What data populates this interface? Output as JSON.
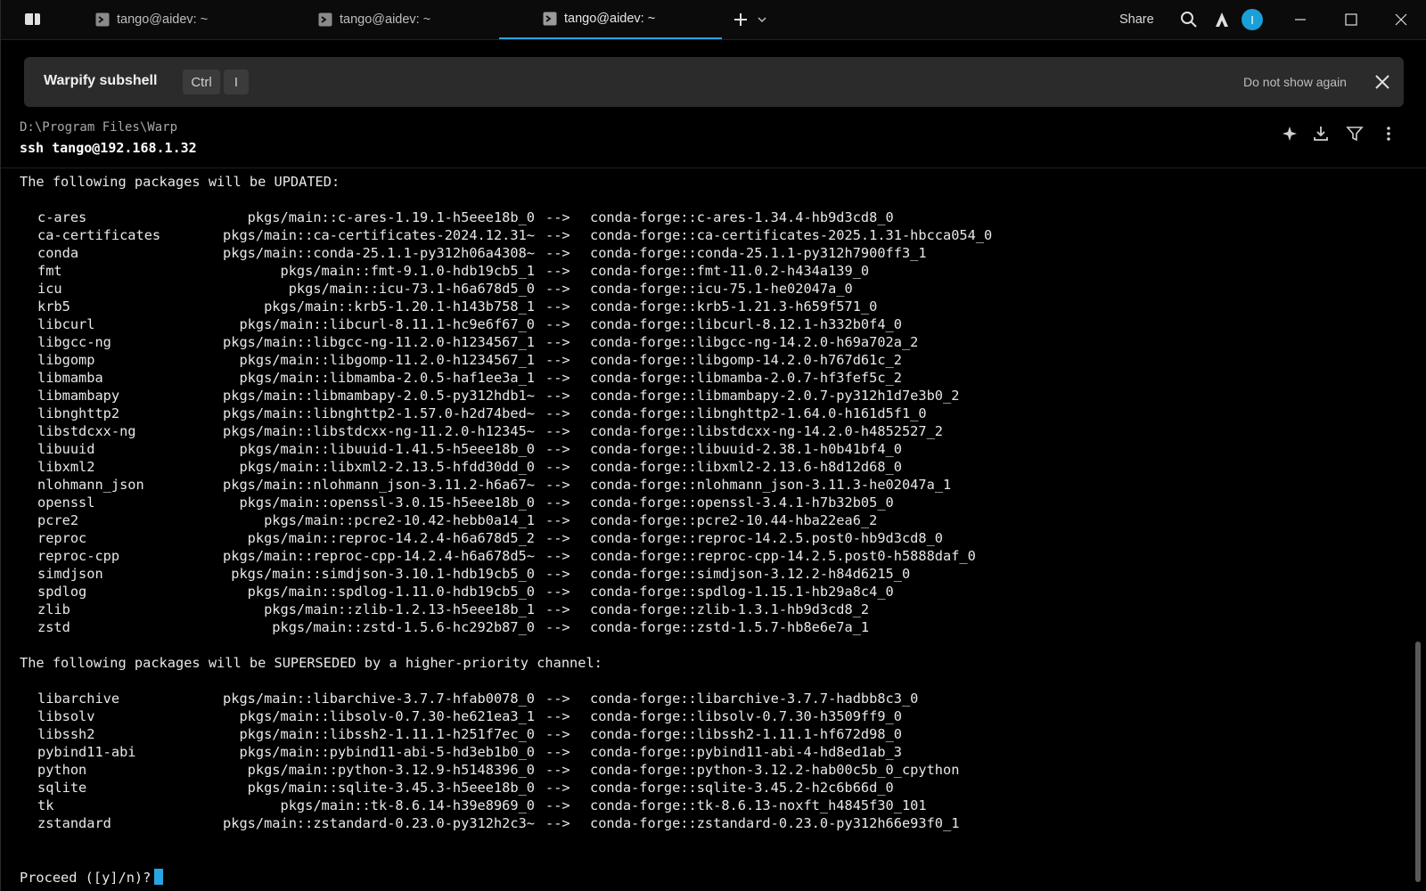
{
  "tabs": [
    {
      "label": "tango@aidev: ~",
      "active": false
    },
    {
      "label": "tango@aidev: ~",
      "active": false
    },
    {
      "label": "tango@aidev: ~",
      "active": true
    }
  ],
  "toolbar": {
    "share_label": "Share",
    "avatar_initial": "I"
  },
  "icons": {
    "app": "warp-app-icon",
    "tab": "terminal-icon",
    "new_tab": "plus-icon",
    "tab_menu": "chevron-down-icon",
    "search": "search-icon",
    "ai": "warp-ai-icon",
    "minimize": "minimize-icon",
    "maximize": "maximize-icon",
    "close": "close-icon"
  },
  "banner": {
    "title": "Warpify subshell",
    "keys": [
      "Ctrl",
      "I"
    ],
    "dismiss_label": "Do not show again"
  },
  "block": {
    "cwd": "D:\\Program Files\\Warp",
    "command": "ssh tango@192.168.1.32"
  },
  "colors": {
    "accent": "#2aa4e0",
    "background": "#000000",
    "banner": "#2b2b2b"
  },
  "output": {
    "updated_heading": "The following packages will be UPDATED:",
    "updated": [
      {
        "name": "c-ares",
        "from": "pkgs/main::c-ares-1.19.1-h5eee18b_0",
        "arrow": "-->",
        "to": "conda-forge::c-ares-1.34.4-hb9d3cd8_0"
      },
      {
        "name": "ca-certificates",
        "from": "pkgs/main::ca-certificates-2024.12.31~",
        "arrow": "-->",
        "to": "conda-forge::ca-certificates-2025.1.31-hbcca054_0"
      },
      {
        "name": "conda",
        "from": "pkgs/main::conda-25.1.1-py312h06a4308~",
        "arrow": "-->",
        "to": "conda-forge::conda-25.1.1-py312h7900ff3_1"
      },
      {
        "name": "fmt",
        "from": "pkgs/main::fmt-9.1.0-hdb19cb5_1",
        "arrow": "-->",
        "to": "conda-forge::fmt-11.0.2-h434a139_0"
      },
      {
        "name": "icu",
        "from": "pkgs/main::icu-73.1-h6a678d5_0",
        "arrow": "-->",
        "to": "conda-forge::icu-75.1-he02047a_0"
      },
      {
        "name": "krb5",
        "from": "pkgs/main::krb5-1.20.1-h143b758_1",
        "arrow": "-->",
        "to": "conda-forge::krb5-1.21.3-h659f571_0"
      },
      {
        "name": "libcurl",
        "from": "pkgs/main::libcurl-8.11.1-hc9e6f67_0",
        "arrow": "-->",
        "to": "conda-forge::libcurl-8.12.1-h332b0f4_0"
      },
      {
        "name": "libgcc-ng",
        "from": "pkgs/main::libgcc-ng-11.2.0-h1234567_1",
        "arrow": "-->",
        "to": "conda-forge::libgcc-ng-14.2.0-h69a702a_2"
      },
      {
        "name": "libgomp",
        "from": "pkgs/main::libgomp-11.2.0-h1234567_1",
        "arrow": "-->",
        "to": "conda-forge::libgomp-14.2.0-h767d61c_2"
      },
      {
        "name": "libmamba",
        "from": "pkgs/main::libmamba-2.0.5-haf1ee3a_1",
        "arrow": "-->",
        "to": "conda-forge::libmamba-2.0.7-hf3fef5c_2"
      },
      {
        "name": "libmambapy",
        "from": "pkgs/main::libmambapy-2.0.5-py312hdb1~",
        "arrow": "-->",
        "to": "conda-forge::libmambapy-2.0.7-py312h1d7e3b0_2"
      },
      {
        "name": "libnghttp2",
        "from": "pkgs/main::libnghttp2-1.57.0-h2d74bed~",
        "arrow": "-->",
        "to": "conda-forge::libnghttp2-1.64.0-h161d5f1_0"
      },
      {
        "name": "libstdcxx-ng",
        "from": "pkgs/main::libstdcxx-ng-11.2.0-h12345~",
        "arrow": "-->",
        "to": "conda-forge::libstdcxx-ng-14.2.0-h4852527_2"
      },
      {
        "name": "libuuid",
        "from": "pkgs/main::libuuid-1.41.5-h5eee18b_0",
        "arrow": "-->",
        "to": "conda-forge::libuuid-2.38.1-h0b41bf4_0"
      },
      {
        "name": "libxml2",
        "from": "pkgs/main::libxml2-2.13.5-hfdd30dd_0",
        "arrow": "-->",
        "to": "conda-forge::libxml2-2.13.6-h8d12d68_0"
      },
      {
        "name": "nlohmann_json",
        "from": "pkgs/main::nlohmann_json-3.11.2-h6a67~",
        "arrow": "-->",
        "to": "conda-forge::nlohmann_json-3.11.3-he02047a_1"
      },
      {
        "name": "openssl",
        "from": "pkgs/main::openssl-3.0.15-h5eee18b_0",
        "arrow": "-->",
        "to": "conda-forge::openssl-3.4.1-h7b32b05_0"
      },
      {
        "name": "pcre2",
        "from": "pkgs/main::pcre2-10.42-hebb0a14_1",
        "arrow": "-->",
        "to": "conda-forge::pcre2-10.44-hba22ea6_2"
      },
      {
        "name": "reproc",
        "from": "pkgs/main::reproc-14.2.4-h6a678d5_2",
        "arrow": "-->",
        "to": "conda-forge::reproc-14.2.5.post0-hb9d3cd8_0"
      },
      {
        "name": "reproc-cpp",
        "from": "pkgs/main::reproc-cpp-14.2.4-h6a678d5~",
        "arrow": "-->",
        "to": "conda-forge::reproc-cpp-14.2.5.post0-h5888daf_0"
      },
      {
        "name": "simdjson",
        "from": "pkgs/main::simdjson-3.10.1-hdb19cb5_0",
        "arrow": "-->",
        "to": "conda-forge::simdjson-3.12.2-h84d6215_0"
      },
      {
        "name": "spdlog",
        "from": "pkgs/main::spdlog-1.11.0-hdb19cb5_0",
        "arrow": "-->",
        "to": "conda-forge::spdlog-1.15.1-hb29a8c4_0"
      },
      {
        "name": "zlib",
        "from": "pkgs/main::zlib-1.2.13-h5eee18b_1",
        "arrow": "-->",
        "to": "conda-forge::zlib-1.3.1-hb9d3cd8_2"
      },
      {
        "name": "zstd",
        "from": "pkgs/main::zstd-1.5.6-hc292b87_0",
        "arrow": "-->",
        "to": "conda-forge::zstd-1.5.7-hb8e6e7a_1"
      }
    ],
    "superseded_heading": "The following packages will be SUPERSEDED by a higher-priority channel:",
    "superseded": [
      {
        "name": "libarchive",
        "from": "pkgs/main::libarchive-3.7.7-hfab0078_0",
        "arrow": "-->",
        "to": "conda-forge::libarchive-3.7.7-hadbb8c3_0"
      },
      {
        "name": "libsolv",
        "from": "pkgs/main::libsolv-0.7.30-he621ea3_1",
        "arrow": "-->",
        "to": "conda-forge::libsolv-0.7.30-h3509ff9_0"
      },
      {
        "name": "libssh2",
        "from": "pkgs/main::libssh2-1.11.1-h251f7ec_0",
        "arrow": "-->",
        "to": "conda-forge::libssh2-1.11.1-hf672d98_0"
      },
      {
        "name": "pybind11-abi",
        "from": "pkgs/main::pybind11-abi-5-hd3eb1b0_0",
        "arrow": "-->",
        "to": "conda-forge::pybind11-abi-4-hd8ed1ab_3"
      },
      {
        "name": "python",
        "from": "pkgs/main::python-3.12.9-h5148396_0",
        "arrow": "-->",
        "to": "conda-forge::python-3.12.2-hab00c5b_0_cpython"
      },
      {
        "name": "sqlite",
        "from": "pkgs/main::sqlite-3.45.3-h5eee18b_0",
        "arrow": "-->",
        "to": "conda-forge::sqlite-3.45.2-h2c6b66d_0"
      },
      {
        "name": "tk",
        "from": "pkgs/main::tk-8.6.14-h39e8969_0",
        "arrow": "-->",
        "to": "conda-forge::tk-8.6.13-noxft_h4845f30_101"
      },
      {
        "name": "zstandard",
        "from": "pkgs/main::zstandard-0.23.0-py312h2c3~",
        "arrow": "-->",
        "to": "conda-forge::zstandard-0.23.0-py312h66e93f0_1"
      }
    ],
    "prompt": "Proceed ([y]/n)?"
  }
}
